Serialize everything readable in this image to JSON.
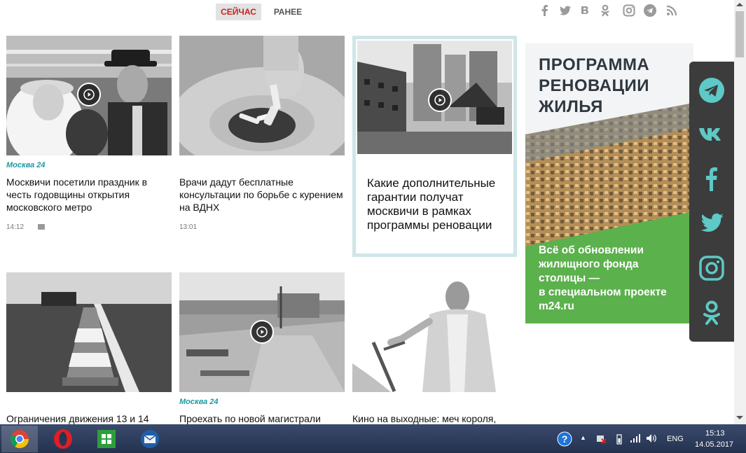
{
  "tabs": {
    "now": "СЕЙЧАС",
    "earlier": "РАНЕЕ"
  },
  "social_top": [
    "facebook-icon",
    "twitter-icon",
    "vk-icon",
    "odnoklassniki-icon",
    "instagram-icon",
    "telegram-icon",
    "rss-icon"
  ],
  "cards": [
    {
      "source": "Москва 24",
      "title": "Москвичи посетили праздник в честь годовщины открытия московского метро",
      "time": "14:12",
      "video": true
    },
    {
      "source": "",
      "title": "Врачи дадут бесплатные консультации по борьбе с курением на ВДНХ",
      "time": "13:01",
      "video": false
    },
    {
      "title": "Какие дополнительные гарантии получат москвичи в рамках программы реновации"
    },
    {
      "title": "Ограничения движения 13 и 14"
    },
    {
      "source": "Москва 24",
      "title": "Проехать по новой магистрали"
    },
    {
      "title": "Кино на выходные: меч короля,"
    }
  ],
  "banner": {
    "title_line1": "ПРОГРАММА",
    "title_line2": "РЕНОВАЦИИ",
    "title_line3": "ЖИЛЬЯ",
    "text_line1": "Всё об обновлении",
    "text_line2": "жилищного фонда",
    "text_line3": "столицы —",
    "text_line4": "в специальном проекте",
    "text_line5": "m24.ru",
    "green": "#5bb14b",
    "dark": "#2f3740"
  },
  "side_social": [
    "telegram-icon",
    "vk-icon",
    "facebook-icon",
    "twitter-icon",
    "instagram-icon",
    "odnoklassniki-icon"
  ],
  "accent": "#5ec9c6",
  "taskbar": {
    "apps": [
      "chrome-icon",
      "opera-icon",
      "windows-store-icon",
      "thunderbird-icon"
    ],
    "lang": "ENG",
    "time": "15:13",
    "date": "14.05.2017"
  }
}
